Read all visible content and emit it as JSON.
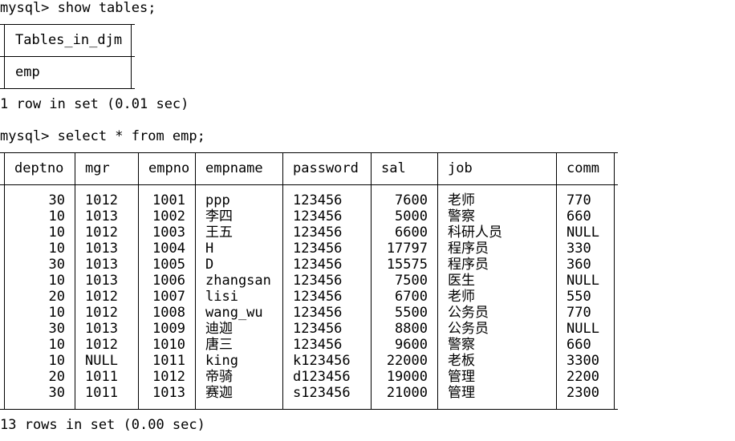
{
  "session": {
    "cmd1": "mysql> show tables;",
    "tables_header": "Tables_in_djm",
    "tables_row": "emp",
    "result1": "1 row in set (0.01 sec)",
    "cmd2": "mysql> select * from emp;",
    "result2": "13 rows in set (0.00 sec)"
  },
  "emp": {
    "columns": [
      "deptno",
      "mgr",
      "empno",
      "empname",
      "password",
      "sal",
      "job",
      "comm"
    ],
    "rows": [
      [
        "30",
        "1012",
        "1001",
        "ppp",
        "123456",
        "7600",
        "老师",
        "770"
      ],
      [
        "10",
        "1013",
        "1002",
        "李四",
        "123456",
        "5000",
        "警察",
        "660"
      ],
      [
        "10",
        "1012",
        "1003",
        "王五",
        "123456",
        "6600",
        "科研人员",
        "NULL"
      ],
      [
        "10",
        "1013",
        "1004",
        "H",
        "123456",
        "17797",
        "程序员",
        "330"
      ],
      [
        "30",
        "1013",
        "1005",
        "D",
        "123456",
        "15575",
        "程序员",
        "360"
      ],
      [
        "10",
        "1013",
        "1006",
        "zhangsan",
        "123456",
        "7500",
        "医生",
        "NULL"
      ],
      [
        "20",
        "1012",
        "1007",
        "lisi",
        "123456",
        "6700",
        "老师",
        "550"
      ],
      [
        "10",
        "1012",
        "1008",
        "wang_wu",
        "123456",
        "5500",
        "公务员",
        "770"
      ],
      [
        "30",
        "1013",
        "1009",
        "迪迦",
        "123456",
        "8800",
        "公务员",
        "NULL"
      ],
      [
        "10",
        "1012",
        "1010",
        "唐三",
        "123456",
        "9600",
        "警察",
        "660"
      ],
      [
        "10",
        "NULL",
        "1011",
        "king",
        "k123456",
        "22000",
        "老板",
        "3300"
      ],
      [
        "20",
        "1011",
        "1012",
        "帝骑",
        "d123456",
        "19000",
        "管理",
        "2200"
      ],
      [
        "30",
        "1011",
        "1013",
        "赛迦",
        "s123456",
        "21000",
        "管理",
        "2300"
      ]
    ]
  }
}
